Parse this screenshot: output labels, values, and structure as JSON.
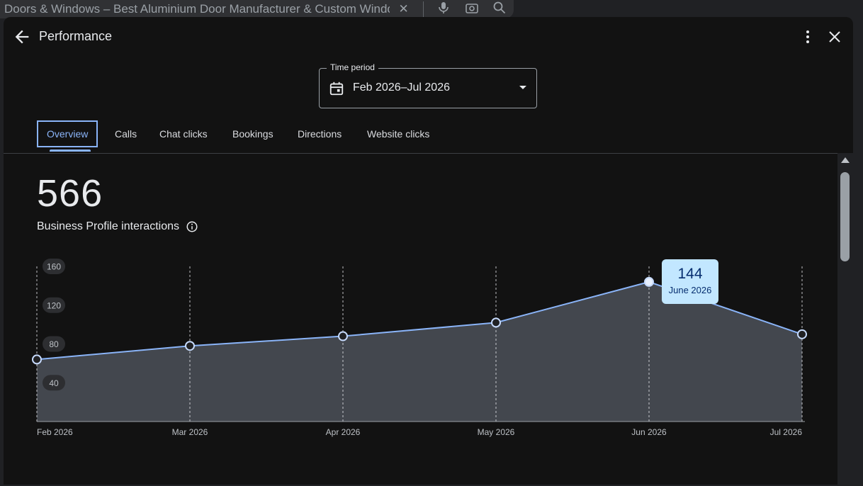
{
  "background": {
    "search_query": "Doors & Windows – Best Aluminium Door Manufacturer & Custom Window S"
  },
  "header": {
    "title": "Performance"
  },
  "time_period": {
    "label": "Time period",
    "value": "Feb 2026–Jul 2026"
  },
  "tabs": [
    {
      "label": "Overview",
      "active": true
    },
    {
      "label": "Calls"
    },
    {
      "label": "Chat clicks"
    },
    {
      "label": "Bookings"
    },
    {
      "label": "Directions"
    },
    {
      "label": "Website clicks"
    }
  ],
  "summary": {
    "total": "566",
    "label": "Business Profile interactions"
  },
  "tooltip": {
    "value": "144",
    "date": "June 2026"
  },
  "colors": {
    "accent": "#8ab4f8",
    "tooltip_bg": "#c2e7ff",
    "area_fill": "#43474e"
  },
  "chart_data": {
    "type": "area",
    "categories": [
      "Feb 2026",
      "Mar 2026",
      "Apr 2026",
      "May 2026",
      "Jun 2026",
      "Jul 2026"
    ],
    "values": [
      64,
      78,
      88,
      102,
      144,
      90
    ],
    "y_ticks": [
      "40",
      "80",
      "120",
      "160"
    ],
    "ylim": [
      0,
      160
    ],
    "grid": "vertical-dashed",
    "highlighted_index": 4
  }
}
